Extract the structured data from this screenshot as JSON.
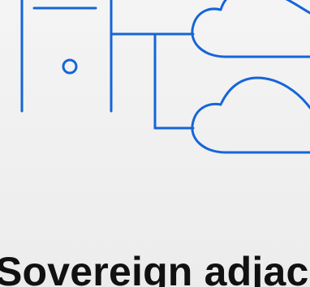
{
  "illustration": {
    "accent_color": "#1565d8",
    "icons": [
      "server-tower-icon",
      "cloud-icon",
      "cloud-icon"
    ]
  },
  "headline": {
    "text": "Sovereign adjacent"
  }
}
